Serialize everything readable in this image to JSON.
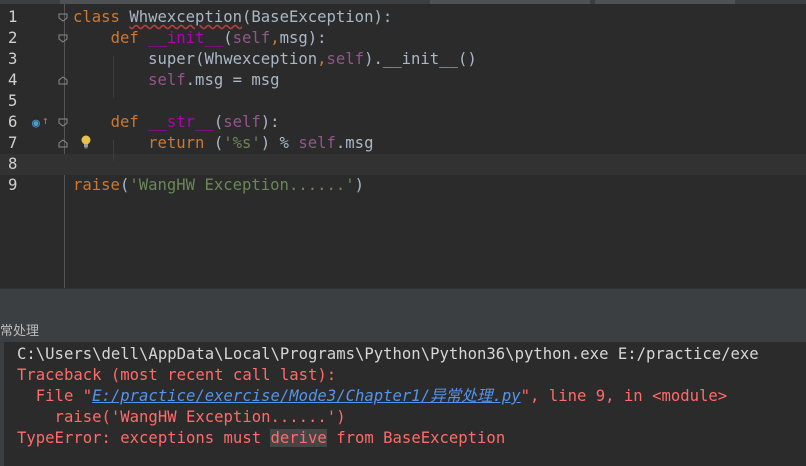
{
  "editor": {
    "lines": [
      {
        "num": "1",
        "tokens": [
          {
            "t": "class ",
            "c": "kw"
          },
          {
            "t": "Whwexception",
            "c": "cls err"
          },
          {
            "t": "(BaseException):",
            "c": ""
          }
        ]
      },
      {
        "num": "2",
        "tokens": [
          {
            "t": "    ",
            "c": ""
          },
          {
            "t": "def ",
            "c": "kw"
          },
          {
            "t": "__init__",
            "c": "magic"
          },
          {
            "t": "(",
            "c": ""
          },
          {
            "t": "self",
            "c": "selfk"
          },
          {
            "t": ",",
            "c": "kw"
          },
          {
            "t": "msg",
            "c": "param"
          },
          {
            "t": "):",
            "c": ""
          }
        ]
      },
      {
        "num": "3",
        "tokens": [
          {
            "t": "        ",
            "c": ""
          },
          {
            "t": "super",
            "c": "fn"
          },
          {
            "t": "(Whwexception",
            "c": ""
          },
          {
            "t": ",",
            "c": "kw"
          },
          {
            "t": "self",
            "c": "selfk"
          },
          {
            "t": ").__init__()",
            "c": ""
          }
        ]
      },
      {
        "num": "4",
        "tokens": [
          {
            "t": "        ",
            "c": ""
          },
          {
            "t": "self",
            "c": "selfk"
          },
          {
            "t": ".msg = msg",
            "c": ""
          }
        ]
      },
      {
        "num": "5",
        "tokens": []
      },
      {
        "num": "6",
        "tokens": [
          {
            "t": "    ",
            "c": ""
          },
          {
            "t": "def ",
            "c": "kw"
          },
          {
            "t": "__str__",
            "c": "magic"
          },
          {
            "t": "(",
            "c": ""
          },
          {
            "t": "self",
            "c": "selfk"
          },
          {
            "t": "):",
            "c": ""
          }
        ]
      },
      {
        "num": "7",
        "tokens": [
          {
            "t": "        ",
            "c": ""
          },
          {
            "t": "return ",
            "c": "kw"
          },
          {
            "t": "(",
            "c": ""
          },
          {
            "t": "'%s'",
            "c": "str"
          },
          {
            "t": ") % ",
            "c": ""
          },
          {
            "t": "self",
            "c": "selfk"
          },
          {
            "t": ".msg",
            "c": ""
          }
        ]
      },
      {
        "num": "8",
        "tokens": []
      },
      {
        "num": "9",
        "tokens": [
          {
            "t": "raise",
            "c": "kw"
          },
          {
            "t": "(",
            "c": ""
          },
          {
            "t": "'WangHW Exception......'",
            "c": "str"
          },
          {
            "t": ")",
            "c": ""
          }
        ]
      }
    ],
    "current_line": 8
  },
  "run_panel": {
    "title": "常处理"
  },
  "console": {
    "command": "C:\\Users\\dell\\AppData\\Local\\Programs\\Python\\Python36\\python.exe E:/practice/exe",
    "traceback_header": "Traceback (most recent call last):",
    "file_prefix": "  File \"",
    "file_link": "E:/practice/exercise/Mode3/Chapter1/异常处理.py",
    "file_suffix": "\", line 9, in <module>",
    "raise_line": "    raise('WangHW Exception......')",
    "error_pre": "TypeError: exceptions must ",
    "error_hl": "derive",
    "error_post": " from BaseException"
  },
  "colors": {
    "background": "#2b2b2b",
    "keyword": "#cc7832",
    "string": "#6a8759",
    "self": "#94558d",
    "magic": "#b200b2",
    "error_text": "#ff6b68",
    "link": "#5394ec"
  }
}
